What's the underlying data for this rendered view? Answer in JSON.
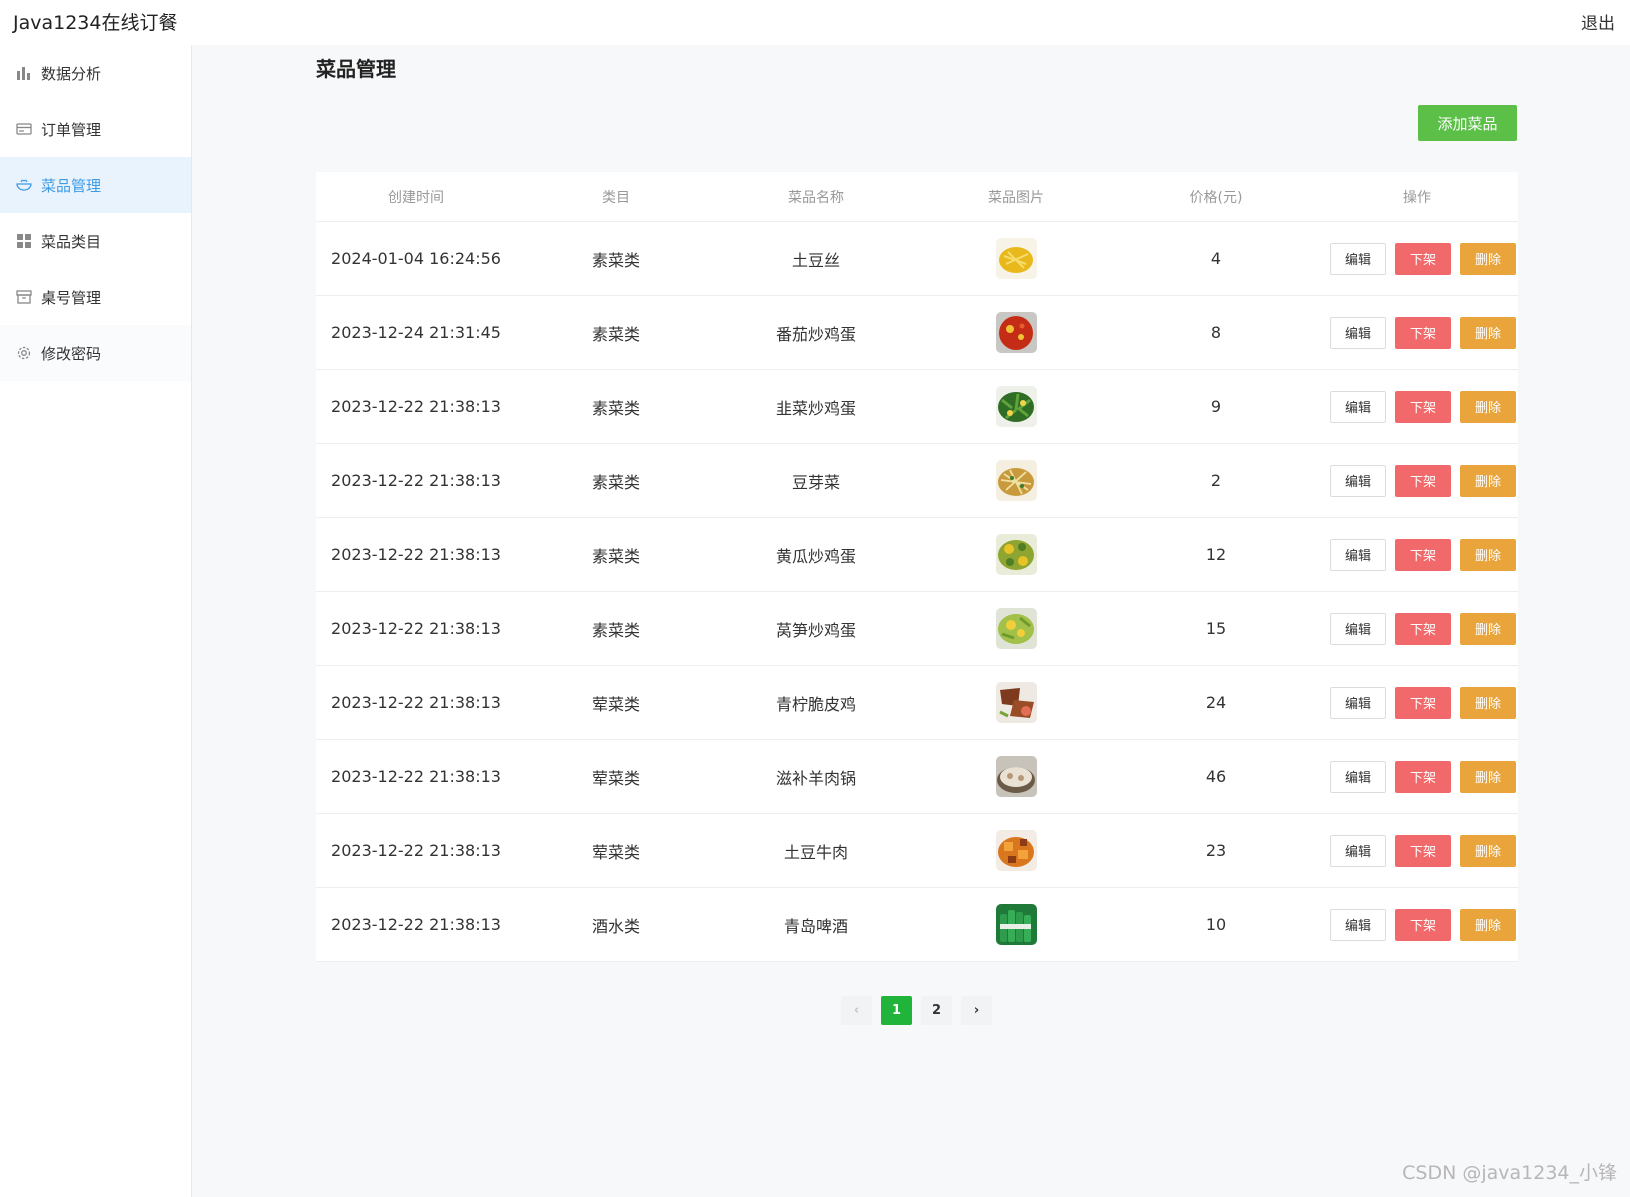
{
  "header": {
    "app_title": "Java1234在线订餐",
    "logout": "退出"
  },
  "sidebar": {
    "items": [
      {
        "label": "数据分析",
        "icon": "bar-chart-icon"
      },
      {
        "label": "订单管理",
        "icon": "card-icon"
      },
      {
        "label": "菜品管理",
        "icon": "bowl-icon",
        "active": true
      },
      {
        "label": "菜品类目",
        "icon": "grid-icon"
      },
      {
        "label": "桌号管理",
        "icon": "box-icon"
      },
      {
        "label": "修改密码",
        "icon": "gear-icon"
      }
    ]
  },
  "main": {
    "page_title": "菜品管理",
    "add_button": "添加菜品",
    "table": {
      "headers": [
        "创建时间",
        "类目",
        "菜品名称",
        "菜品图片",
        "价格(元)",
        "操作"
      ],
      "rows": [
        {
          "created": "2024-01-04 16:24:56",
          "category": "素菜类",
          "name": "土豆丝",
          "price": "4"
        },
        {
          "created": "2023-12-24 21:31:45",
          "category": "素菜类",
          "name": "番茄炒鸡蛋",
          "price": "8"
        },
        {
          "created": "2023-12-22 21:38:13",
          "category": "素菜类",
          "name": "韭菜炒鸡蛋",
          "price": "9"
        },
        {
          "created": "2023-12-22 21:38:13",
          "category": "素菜类",
          "name": "豆芽菜",
          "price": "2"
        },
        {
          "created": "2023-12-22 21:38:13",
          "category": "素菜类",
          "name": "黄瓜炒鸡蛋",
          "price": "12"
        },
        {
          "created": "2023-12-22 21:38:13",
          "category": "素菜类",
          "name": "莴笋炒鸡蛋",
          "price": "15"
        },
        {
          "created": "2023-12-22 21:38:13",
          "category": "荤菜类",
          "name": "青柠脆皮鸡",
          "price": "24"
        },
        {
          "created": "2023-12-22 21:38:13",
          "category": "荤菜类",
          "name": "滋补羊肉锅",
          "price": "46"
        },
        {
          "created": "2023-12-22 21:38:13",
          "category": "荤菜类",
          "name": "土豆牛肉",
          "price": "23"
        },
        {
          "created": "2023-12-22 21:38:13",
          "category": "酒水类",
          "name": "青岛啤酒",
          "price": "10"
        }
      ],
      "actions": {
        "edit": "编辑",
        "off_shelf": "下架",
        "delete": "删除"
      }
    },
    "pagination": {
      "prev": "‹",
      "pages": [
        "1",
        "2"
      ],
      "current": "1",
      "next": "›"
    }
  },
  "watermark": "CSDN @java1234_小锋",
  "colors": {
    "accent": "#3e9be5",
    "add_button": "#5bbf48",
    "off_shelf": "#f1696a",
    "delete": "#e9a43c",
    "page_active": "#21b43a"
  }
}
